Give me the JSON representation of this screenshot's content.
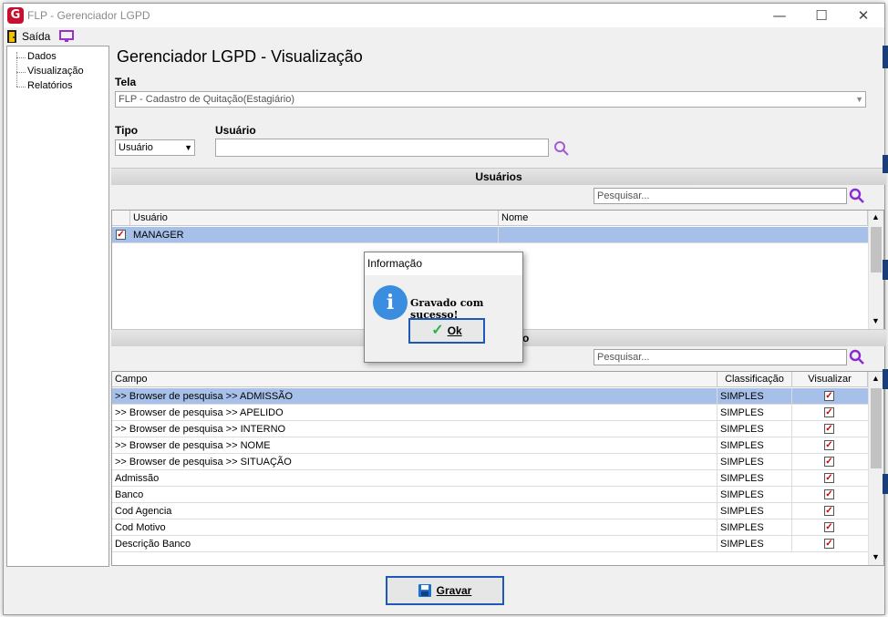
{
  "window": {
    "title": "FLP - Gerenciador LGPD",
    "app_icon_letter": "G",
    "minimize": "—",
    "maximize": "☐",
    "close": "✕"
  },
  "menu": {
    "exit_label": "Saída"
  },
  "tree": {
    "items": [
      {
        "label": "Dados"
      },
      {
        "label": "Visualização"
      },
      {
        "label": "Relatórios"
      }
    ]
  },
  "page": {
    "heading": "Gerenciador LGPD - Visualização"
  },
  "form": {
    "tela_label": "Tela",
    "tela_value": "FLP - Cadastro de Quitação(Estagiário)",
    "tipo_label": "Tipo",
    "tipo_value": "Usuário",
    "usuario_label": "Usuário",
    "usuario_value": ""
  },
  "users_section": {
    "title": "Usuários",
    "search_placeholder": "Pesquisar...",
    "columns": [
      "Usuário",
      "Nome"
    ],
    "rows": [
      {
        "usuario": "MANAGER",
        "nome": "",
        "checked": true
      }
    ]
  },
  "fields_section": {
    "title_fragment": "o",
    "search_placeholder": "Pesquisar...",
    "columns": [
      "Campo",
      "Classificação",
      "Visualizar"
    ],
    "rows": [
      {
        "campo": ">> Browser de pesquisa >> ADMISSÃO",
        "classificacao": "SIMPLES",
        "visualizar": true
      },
      {
        "campo": ">> Browser de pesquisa >> APELIDO",
        "classificacao": "SIMPLES",
        "visualizar": true
      },
      {
        "campo": ">> Browser de pesquisa >> INTERNO",
        "classificacao": "SIMPLES",
        "visualizar": true
      },
      {
        "campo": ">> Browser de pesquisa >> NOME",
        "classificacao": "SIMPLES",
        "visualizar": true
      },
      {
        "campo": ">> Browser de pesquisa >> SITUAÇÃO",
        "classificacao": "SIMPLES",
        "visualizar": true
      },
      {
        "campo": "Admissão",
        "classificacao": "SIMPLES",
        "visualizar": true
      },
      {
        "campo": "Banco",
        "classificacao": "SIMPLES",
        "visualizar": true
      },
      {
        "campo": "Cod Agencia",
        "classificacao": "SIMPLES",
        "visualizar": true
      },
      {
        "campo": "Cod Motivo",
        "classificacao": "SIMPLES",
        "visualizar": true
      },
      {
        "campo": "Descrição Banco",
        "classificacao": "SIMPLES",
        "visualizar": true
      }
    ]
  },
  "dialog": {
    "title": "Informação",
    "icon_letter": "i",
    "message": "Gravado com sucesso!",
    "ok_label": "Ok"
  },
  "footer": {
    "save_label": "Gravar"
  },
  "colors": {
    "accent": "#1e5ab4",
    "selected_row": "#a7c0ea",
    "check": "#cc0000",
    "info": "#3b8de0"
  }
}
